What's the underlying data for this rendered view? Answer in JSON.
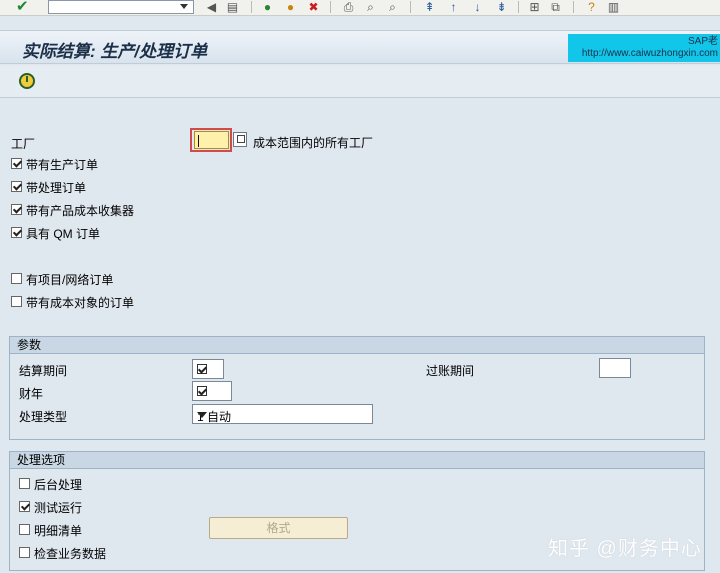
{
  "toolbar": {
    "command_field": "",
    "icons": [
      "enter-icon",
      "back-icon",
      "save-icon",
      "back-nav-icon",
      "exit-icon",
      "cancel-icon",
      "print-icon",
      "find-icon",
      "find-next-icon",
      "first-page-icon",
      "previous-page-icon",
      "next-page-icon",
      "last-page-icon",
      "new-session-icon",
      "shortcut-icon",
      "help-icon",
      "layout-icon"
    ]
  },
  "title": "实际结算: 生产/处理订单",
  "brand": {
    "line1": "SAP老",
    "line2": "http://www.caiwuzhongxin.com"
  },
  "selection": {
    "plant_label": "工厂",
    "plant_value": "",
    "plant_hint": "成本范围内的所有工厂",
    "options": [
      {
        "label": "带有生产订单",
        "checked": true
      },
      {
        "label": "带处理订单",
        "checked": true
      },
      {
        "label": "带有产品成本收集器",
        "checked": true
      },
      {
        "label": "具有 QM 订单",
        "checked": true
      },
      {
        "label": "有项目/网络订单",
        "checked": false
      },
      {
        "label": "带有成本对象的订单",
        "checked": false
      }
    ]
  },
  "parameters": {
    "header": "参数",
    "settlement_period_label": "结算期间",
    "posting_period_label": "过账期间",
    "fiscal_year_label": "财年",
    "processing_type_label": "处理类型",
    "processing_type_value": "1 自动"
  },
  "processing_options": {
    "header": "处理选项",
    "items": [
      {
        "label": "后台处理",
        "checked": false
      },
      {
        "label": "测试运行",
        "checked": true
      },
      {
        "label": "明细清单",
        "checked": false
      },
      {
        "label": "检查业务数据",
        "checked": false
      }
    ],
    "format_button": "格式"
  },
  "watermark": "知乎 @财务中心",
  "colors": {
    "background": "#dfe7ef",
    "required_border": "#d04b4b",
    "required_fill": "#fff1a9",
    "group_header": "#c9d7e5"
  }
}
